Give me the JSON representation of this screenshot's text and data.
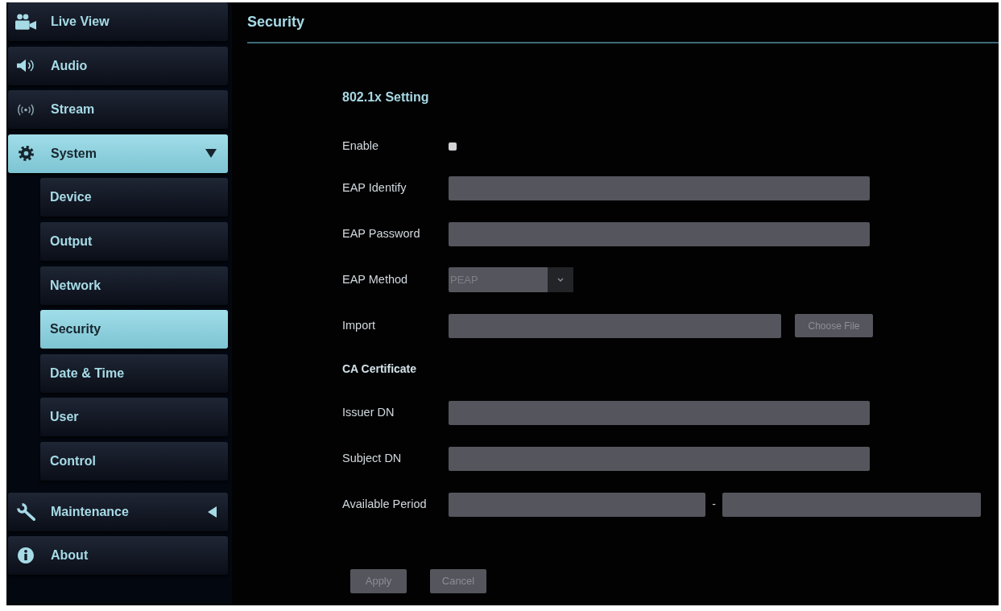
{
  "sidebar": {
    "items": [
      {
        "label": "Live View",
        "selected": false
      },
      {
        "label": "Audio",
        "selected": false
      },
      {
        "label": "Stream",
        "selected": false
      },
      {
        "label": "System",
        "selected": true,
        "expanded": true,
        "children": [
          {
            "label": "Device",
            "selected": false
          },
          {
            "label": "Output",
            "selected": false
          },
          {
            "label": "Network",
            "selected": false
          },
          {
            "label": "Security",
            "selected": true
          },
          {
            "label": "Date & Time",
            "selected": false
          },
          {
            "label": "User",
            "selected": false
          },
          {
            "label": "Control",
            "selected": false
          }
        ]
      },
      {
        "label": "Maintenance",
        "selected": false,
        "expanded": false
      },
      {
        "label": "About",
        "selected": false
      }
    ]
  },
  "header": {
    "title": "Security"
  },
  "form": {
    "title": "802.1x Setting",
    "rows": [
      {
        "kind": "checkbox",
        "label": "Enable",
        "checked": false
      },
      {
        "kind": "text",
        "label": "EAP Identify"
      },
      {
        "kind": "password",
        "label": "EAP Password"
      },
      {
        "kind": "select",
        "label": "EAP Method",
        "value": "PEAP"
      },
      {
        "kind": "file",
        "label": "Import",
        "button": {
          "label": "Choose File",
          "disabled": true
        }
      },
      {
        "kind": "heading",
        "label": "CA Certificate"
      },
      {
        "kind": "text",
        "label": "Issuer DN"
      },
      {
        "kind": "text",
        "label": "Subject DN"
      },
      {
        "kind": "range",
        "label": "Available Period",
        "separator": "-"
      }
    ]
  },
  "buttons": [
    {
      "label": "Apply",
      "disabled": true
    },
    {
      "label": "Cancel",
      "disabled": true
    }
  ]
}
